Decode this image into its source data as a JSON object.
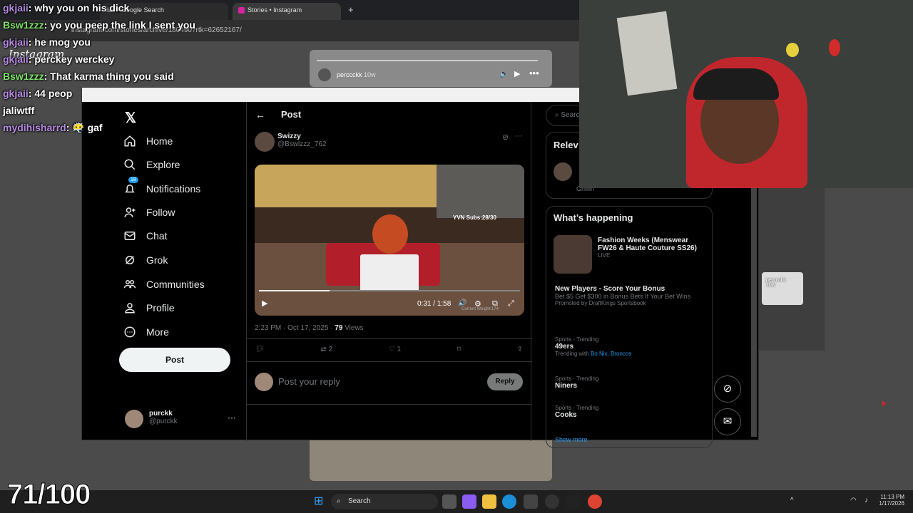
{
  "chat": [
    {
      "user": "gkjaii",
      "user_color": "#b58ae3",
      "msg": "why you on his dick"
    },
    {
      "user": "Bsw1zzz",
      "user_color": "#7ee36a",
      "msg": "yo you peep the link I sent you"
    },
    {
      "user": "gkjaii",
      "user_color": "#b58ae3",
      "msg": "he mog you"
    },
    {
      "user": "gkjaii",
      "user_color": "#b58ae3",
      "msg": "perckey werckey"
    },
    {
      "user": "Bsw1zzz",
      "user_color": "#7ee36a",
      "msg": "That karma thing you said"
    },
    {
      "user": "gkjaii",
      "user_color": "#b58ae3",
      "msg": "44 peop"
    },
    {
      "user": "",
      "user_color": "#ffffff",
      "msg": "jaliwtff"
    },
    {
      "user": "mydihisharrd",
      "user_color": "#b58ae3",
      "msg": "gaf"
    }
  ],
  "browser": {
    "tab1": "Google Search",
    "tab1_partial": "iliar - Google Search",
    "tab2": "Stories • Instagram",
    "address": "instagram.com/stories/archive/180490?rtk=62652167/",
    "instagram_logo": "Instagram",
    "ig_user": "perccckk",
    "ig_time": "10w"
  },
  "x": {
    "nav": [
      "Home",
      "Explore",
      "Notifications",
      "Follow",
      "Chat",
      "Grok",
      "Communities",
      "Profile",
      "More"
    ],
    "notif_badge": "18",
    "post_button": "Post",
    "account_name": "purckk",
    "account_handle": "@purckk",
    "header": "Post",
    "author_name": "Swizzy",
    "author_handle": "@Bswlzzz_762",
    "video_time": "0:31 / 1:58",
    "video_overlay": "YVN Subs:28/30",
    "video_weight": "Current Weight:174",
    "timestamp": "2:23 PM · Oct 17, 2025 ·",
    "views_count": "79",
    "views_label": "Views",
    "retweets": "2",
    "likes": "1",
    "reply_placeholder": "Post your reply",
    "reply_button": "Reply",
    "search_placeholder": "Searc",
    "relevant_title": "Relev",
    "relevant_sub": "Grilllin",
    "happening_title": "What’s happening",
    "trends": [
      {
        "title": "Fashion Weeks (Menswear FW26 & Haute Couture SS26)",
        "meta": "LIVE"
      },
      {
        "title": "New Players - Score Your Bonus",
        "body": "Bet $5 Get $300 in Bonus Bets If Your Bet Wins",
        "meta": "Promoted by DraftKings Sportsbook"
      },
      {
        "meta": "Sports · Trending",
        "title": "49ers",
        "extra": "Trending with",
        "links": "Bo Nix, Broncos"
      },
      {
        "meta": "Sports · Trending",
        "title": "Niners"
      },
      {
        "meta": "Sports · Trending",
        "title": "Cooks"
      }
    ],
    "show_more": "Show more"
  },
  "side_panel": {
    "user": "perccckk",
    "time": "10w"
  },
  "taskbar": {
    "search": "Search",
    "time": "11:13 PM",
    "date": "1/17/2026"
  },
  "score": "71/100"
}
